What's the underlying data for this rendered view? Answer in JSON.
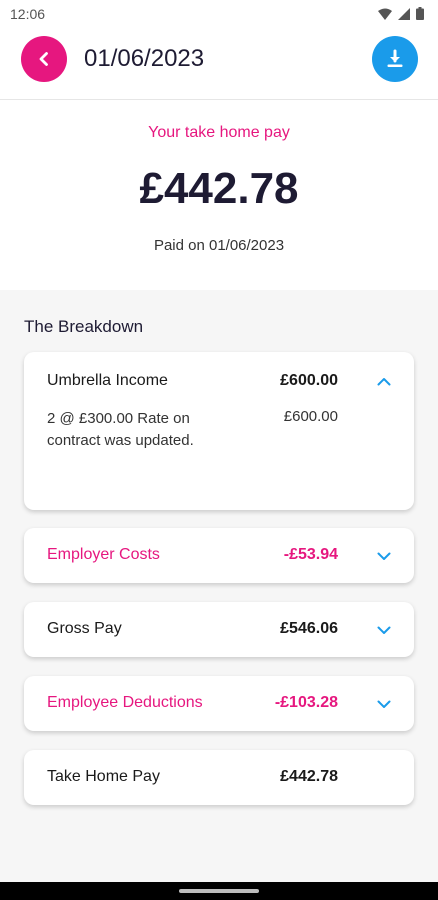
{
  "status": {
    "time": "12:06"
  },
  "header": {
    "title": "01/06/2023"
  },
  "hero": {
    "label": "Your take home pay",
    "amount": "£442.78",
    "paid_on": "Paid on 01/06/2023"
  },
  "breakdown": {
    "title": "The Breakdown",
    "umbrella": {
      "label": "Umbrella Income",
      "value": "£600.00",
      "detail_text": "2 @ £300.00 Rate on contract was updated.",
      "detail_value": "£600.00",
      "expanded": true
    },
    "employer_costs": {
      "label": "Employer Costs",
      "value": "-£53.94"
    },
    "gross_pay": {
      "label": "Gross Pay",
      "value": "£546.06"
    },
    "employee_deductions": {
      "label": "Employee Deductions",
      "value": "-£103.28"
    },
    "take_home": {
      "label": "Take Home Pay",
      "value": "£442.78"
    }
  },
  "colors": {
    "accent_pink": "#e6177f",
    "accent_blue": "#1a9bea",
    "dark_text": "#1e1b33"
  },
  "icons": {
    "back": "chevron-left-icon",
    "download": "download-icon",
    "expand": "chevron-down-icon",
    "collapse": "chevron-up-icon"
  }
}
